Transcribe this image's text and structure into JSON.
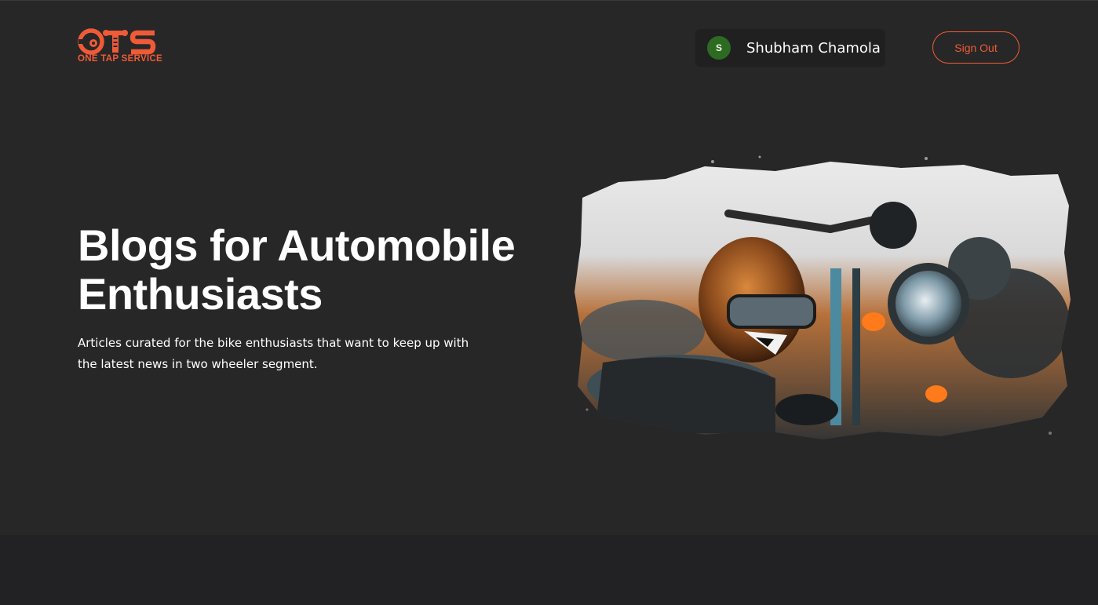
{
  "brand": {
    "logo_text": "OTS",
    "tagline": "ONE TAP SERVICE",
    "color": "#ef5b37"
  },
  "user": {
    "initial": "S",
    "name": "Shubham Chamola",
    "avatar_color": "#2d6b22"
  },
  "header": {
    "sign_out_label": "Sign Out"
  },
  "hero": {
    "title": "Blogs for Automobile Enthusiasts",
    "subtitle": "Articles curated for the bike enthusiasts that want to keep up with the latest news in two wheeler segment.",
    "image_icon": "motorcycle-helmet-photo"
  },
  "theme": {
    "background": "#272728",
    "footer_band": "#222224"
  }
}
